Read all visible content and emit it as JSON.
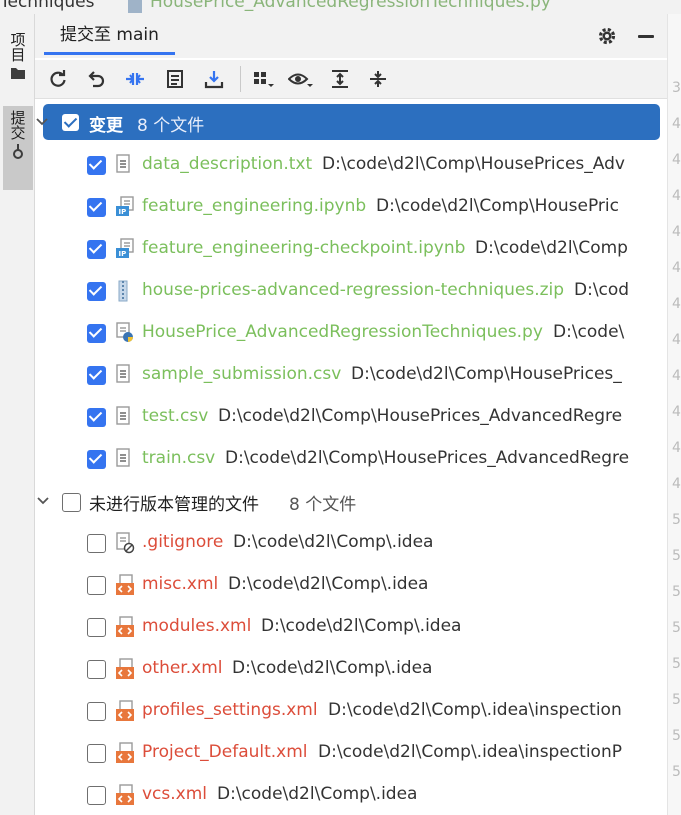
{
  "window": {
    "title_fragment": "Techniques",
    "file_fragment": "HousePrice_AdvancedRegressionTechniques.py"
  },
  "side_tabs": [
    {
      "label": "项目",
      "icon": "folder-icon"
    },
    {
      "label": "提交",
      "icon": "commit-icon"
    }
  ],
  "panel": {
    "tab_label": "提交至 main"
  },
  "toolbar": [
    "refresh-icon",
    "rollback-icon",
    "diff-icon",
    "shelve-icon",
    "update-icon",
    "group-by-icon",
    "view-options-icon",
    "expand-all-icon",
    "collapse-all-icon"
  ],
  "changes": {
    "label": "变更",
    "count": "8 个文件",
    "files": [
      {
        "name": "data_description.txt",
        "path": "D:\\code\\d2l\\Comp\\HousePrices_Adv",
        "icon": "text-file-icon"
      },
      {
        "name": "feature_engineering.ipynb",
        "path": "D:\\code\\d2l\\Comp\\HousePric",
        "icon": "notebook-file-icon"
      },
      {
        "name": "feature_engineering-checkpoint.ipynb",
        "path": "D:\\code\\d2l\\Comp",
        "icon": "notebook-file-icon"
      },
      {
        "name": "house-prices-advanced-regression-techniques.zip",
        "path": "D:\\cod",
        "icon": "archive-file-icon"
      },
      {
        "name": "HousePrice_AdvancedRegressionTechniques.py",
        "path": "D:\\code\\",
        "icon": "python-file-icon"
      },
      {
        "name": "sample_submission.csv",
        "path": "D:\\code\\d2l\\Comp\\HousePrices_",
        "icon": "text-file-icon"
      },
      {
        "name": "test.csv",
        "path": "D:\\code\\d2l\\Comp\\HousePrices_AdvancedRegre",
        "icon": "text-file-icon"
      },
      {
        "name": "train.csv",
        "path": "D:\\code\\d2l\\Comp\\HousePrices_AdvancedRegre",
        "icon": "text-file-icon"
      }
    ]
  },
  "unversioned": {
    "label": "未进行版本管理的文件",
    "count": "8 个文件",
    "files": [
      {
        "name": ".gitignore",
        "path": "D:\\code\\d2l\\Comp\\.idea",
        "icon": "ignore-file-icon"
      },
      {
        "name": "misc.xml",
        "path": "D:\\code\\d2l\\Comp\\.idea",
        "icon": "xml-file-icon"
      },
      {
        "name": "modules.xml",
        "path": "D:\\code\\d2l\\Comp\\.idea",
        "icon": "xml-file-icon"
      },
      {
        "name": "other.xml",
        "path": "D:\\code\\d2l\\Comp\\.idea",
        "icon": "xml-file-icon"
      },
      {
        "name": "profiles_settings.xml",
        "path": "D:\\code\\d2l\\Comp\\.idea\\inspection",
        "icon": "xml-file-icon"
      },
      {
        "name": "Project_Default.xml",
        "path": "D:\\code\\d2l\\Comp\\.idea\\inspectionP",
        "icon": "xml-file-icon"
      },
      {
        "name": "vcs.xml",
        "path": "D:\\code\\d2l\\Comp\\.idea",
        "icon": "xml-file-icon"
      }
    ]
  },
  "gutter_digits": [
    "3",
    "4",
    "4",
    "4",
    "4",
    "4",
    "4",
    "4",
    "4",
    "4",
    "4",
    "4",
    "5",
    "5",
    "5",
    "5",
    "5",
    "5",
    "5",
    "5"
  ],
  "colors": {
    "accent": "#3574f0",
    "selection": "#2c6fbf",
    "added": "#7bbf5c",
    "untracked": "#dc4d3a"
  }
}
